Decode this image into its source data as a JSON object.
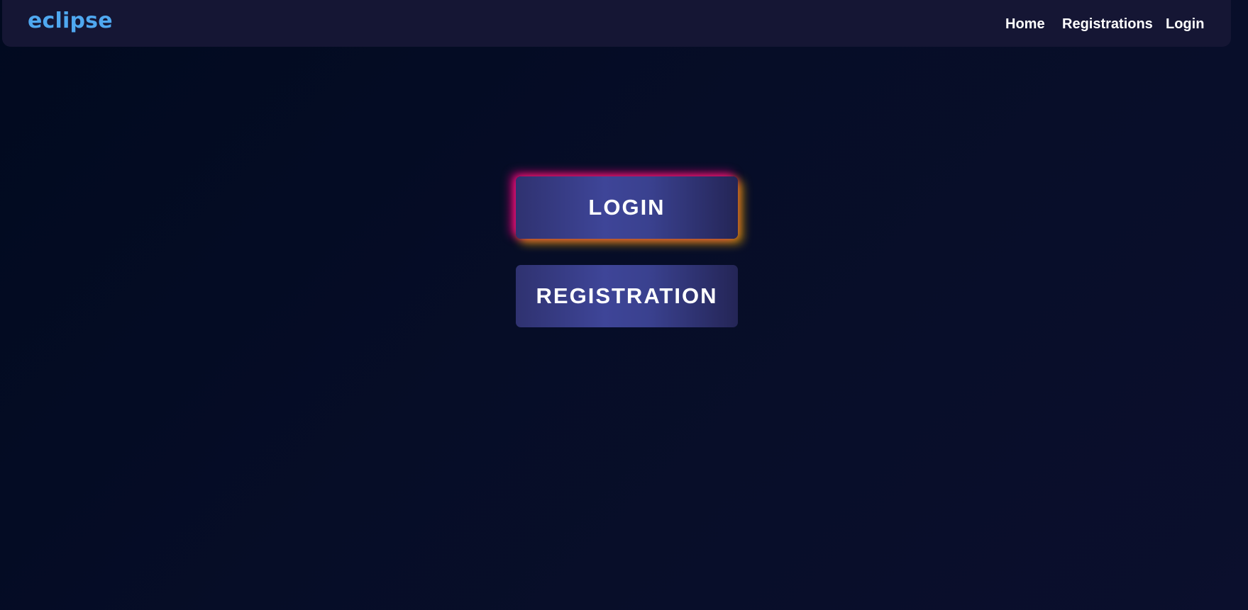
{
  "navbar": {
    "brand": "eclipse",
    "links": [
      {
        "label": "Home"
      },
      {
        "label": "Registrations"
      },
      {
        "label": "Login"
      }
    ]
  },
  "main": {
    "login_label": "LOGIN",
    "registration_label": "REGISTRATION"
  },
  "colors": {
    "background": "#030b22",
    "navbar": "#151634",
    "brand": "#4fa8f0",
    "button": "#3a418f",
    "glow_pink": "#ff008c",
    "glow_yellow": "#ffb400"
  }
}
